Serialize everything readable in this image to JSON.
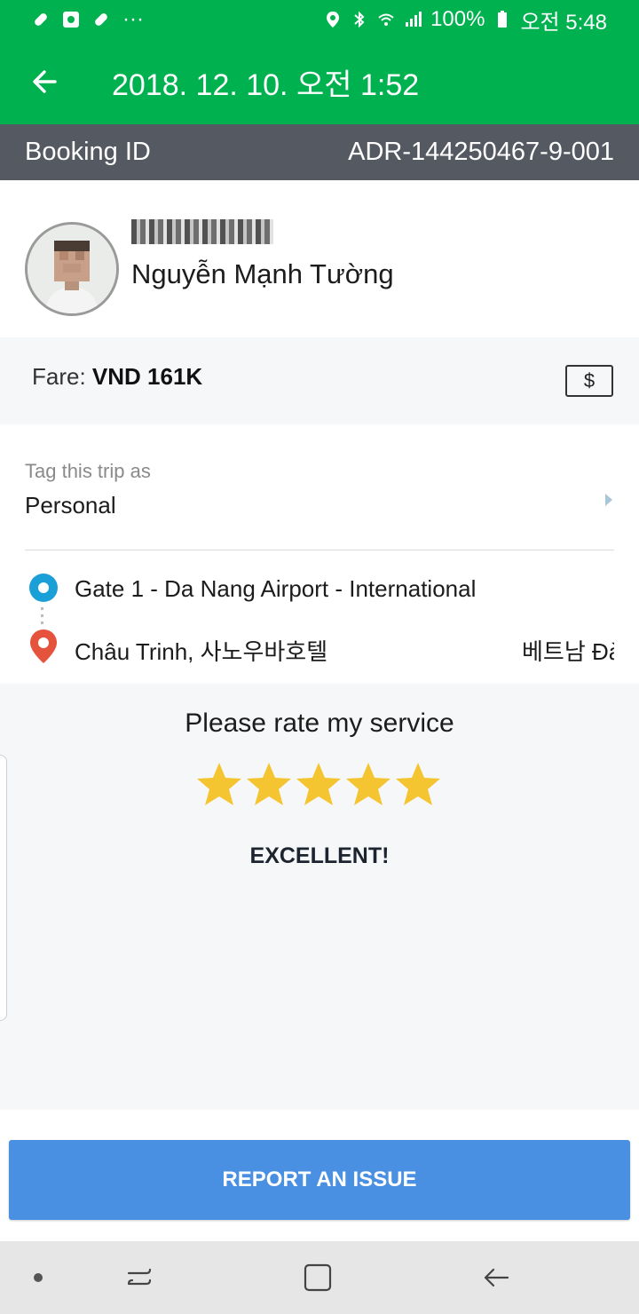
{
  "status_bar": {
    "left_icons": [
      "pill-icon",
      "maps-icon",
      "pill-icon",
      "more-dots-icon"
    ],
    "more": "···",
    "battery": "100%",
    "time": "오전 5:48"
  },
  "app_bar": {
    "title": "2018. 12. 10. 오전 1:52"
  },
  "booking": {
    "label": "Booking ID",
    "id": "ADR-144250467-9-001"
  },
  "driver": {
    "name": "Nguyễn Mạnh Tường"
  },
  "fare": {
    "label": "Fare:",
    "value": "VND 161K",
    "payment_symbol": "$"
  },
  "tag": {
    "label": "Tag this trip as",
    "value": "Personal"
  },
  "route": {
    "pickup": "Gate 1 - Da Nang Airport - International",
    "dropoff": "Châu Trinh, 사노우바호텔",
    "dropoff_right": "베트남 Đà"
  },
  "rating": {
    "title": "Please rate my service",
    "stars": 5,
    "stars_max": 5,
    "result": "EXCELLENT!",
    "star_color": "#f5c431"
  },
  "report": {
    "label": "REPORT AN ISSUE"
  },
  "colors": {
    "brand_green": "#00b14f",
    "booking_bar": "#555a62",
    "report_button": "#4a90e2",
    "pickup_dot": "#1a9fd6",
    "dropoff_pin": "#e5533d"
  }
}
